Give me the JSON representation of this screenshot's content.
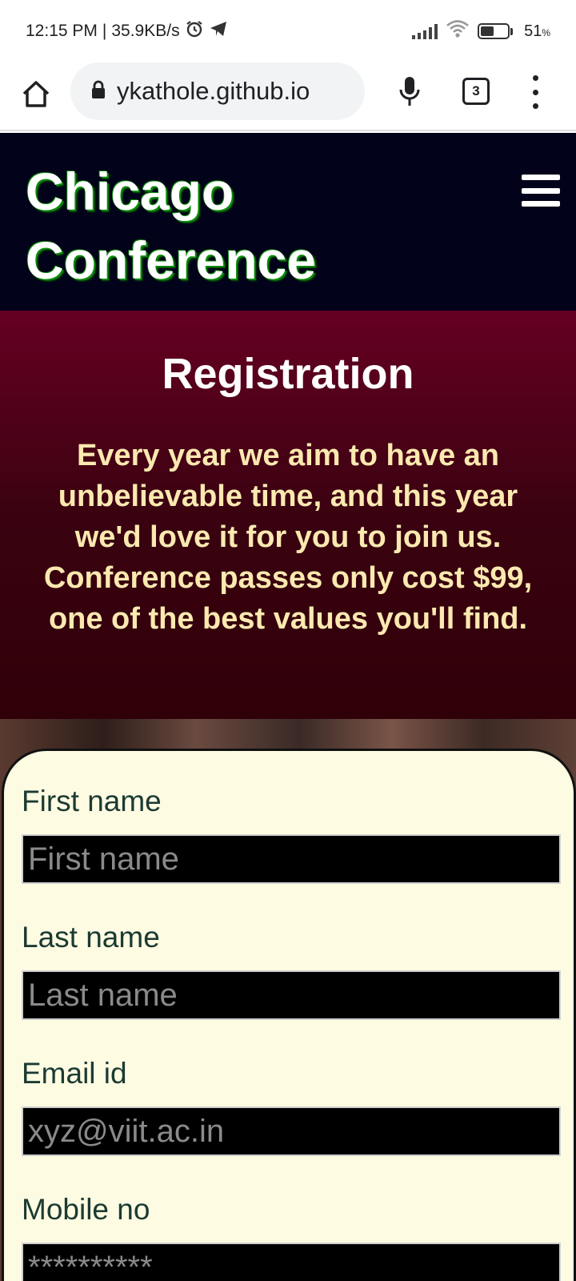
{
  "status_bar": {
    "time": "12:15 PM",
    "separator": "|",
    "speed": "35.9KB/s",
    "battery": "51",
    "battery_unit": "%"
  },
  "browser": {
    "url": "ykathole.github.io",
    "tab_count": "3",
    "icons": [
      "home-icon",
      "lock-icon",
      "mic-icon",
      "tabs-icon",
      "more-icon"
    ]
  },
  "site": {
    "title_line1": "Chicago",
    "title_line2": "Conference",
    "menu_icon": "hamburger-icon"
  },
  "registration": {
    "heading": "Registration",
    "text": "Every year we aim to have an unbelievable time, and this year we'd love it for you to join us. Conference passes only cost $99, one of the best values you'll find."
  },
  "form": {
    "first_name_label": "First name",
    "first_name_placeholder": "First name",
    "last_name_label": "Last name",
    "last_name_placeholder": "Last name",
    "email_label": "Email id",
    "email_placeholder": "xyz@viit.ac.in",
    "mobile_label": "Mobile no",
    "mobile_placeholder": "**********"
  },
  "colors": {
    "header_bg": "#02021a",
    "registration_bg_top": "#660022",
    "registration_text": "#fbe9b0",
    "form_bg": "#fdfbe2",
    "input_bg": "#000000"
  }
}
